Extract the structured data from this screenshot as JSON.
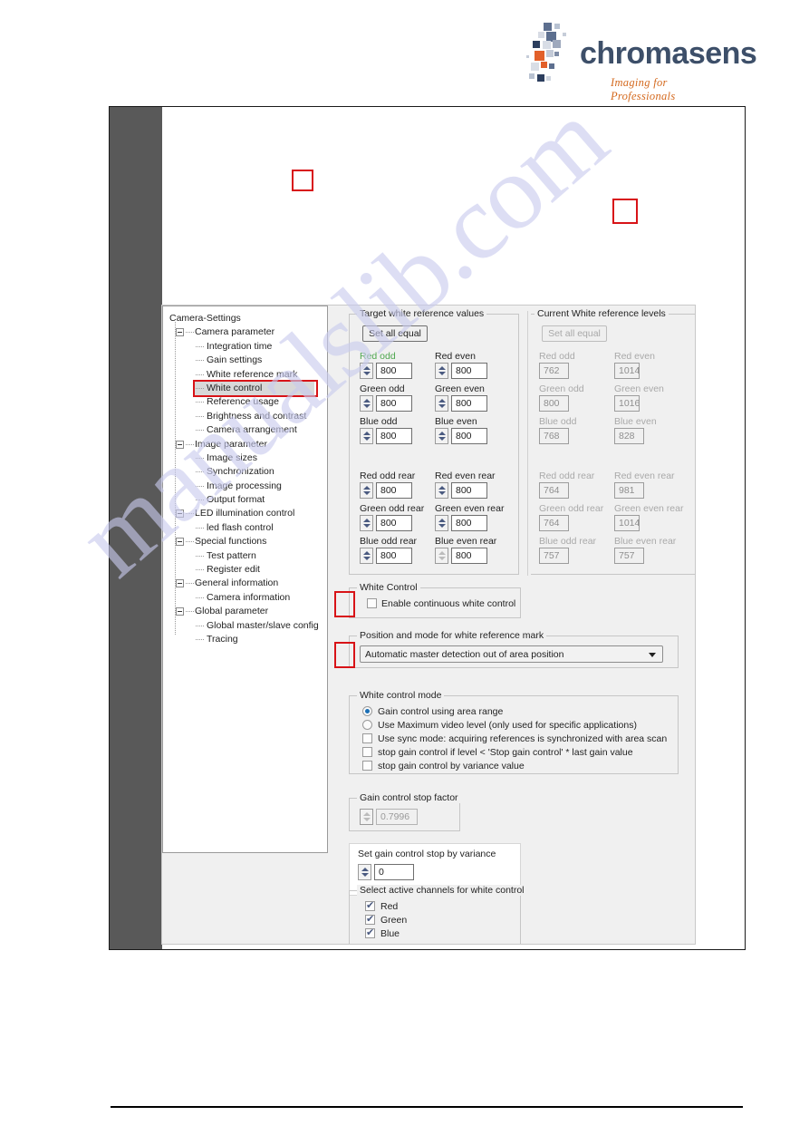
{
  "brand": {
    "name": "chromasens",
    "tagline": "Imaging for Professionals"
  },
  "watermark": "manualslib.com",
  "tree": {
    "root": "Camera-Settings",
    "items": [
      {
        "label": "Camera parameter",
        "depth": 1,
        "expander": true
      },
      {
        "label": "Integration time",
        "depth": 2,
        "expander": false
      },
      {
        "label": "Gain settings",
        "depth": 2,
        "expander": false
      },
      {
        "label": "White reference mark",
        "depth": 2,
        "expander": false
      },
      {
        "label": "White control",
        "depth": 2,
        "expander": false,
        "selected": true
      },
      {
        "label": "Reference usage",
        "depth": 2,
        "expander": false
      },
      {
        "label": "Brightness and contrast",
        "depth": 2,
        "expander": false
      },
      {
        "label": "Camera arrangement",
        "depth": 2,
        "expander": false
      },
      {
        "label": "Image parameter",
        "depth": 1,
        "expander": true
      },
      {
        "label": "Image sizes",
        "depth": 2,
        "expander": false
      },
      {
        "label": "Synchronization",
        "depth": 2,
        "expander": false
      },
      {
        "label": "Image processing",
        "depth": 2,
        "expander": false
      },
      {
        "label": "Output format",
        "depth": 2,
        "expander": false
      },
      {
        "label": "LED illumination control",
        "depth": 1,
        "expander": true
      },
      {
        "label": "led flash control",
        "depth": 2,
        "expander": false
      },
      {
        "label": "Special functions",
        "depth": 1,
        "expander": true
      },
      {
        "label": "Test pattern",
        "depth": 2,
        "expander": false
      },
      {
        "label": "Register edit",
        "depth": 2,
        "expander": false
      },
      {
        "label": "General information",
        "depth": 1,
        "expander": true
      },
      {
        "label": "Camera information",
        "depth": 2,
        "expander": false
      },
      {
        "label": "Global parameter",
        "depth": 1,
        "expander": true
      },
      {
        "label": "Global master/slave config",
        "depth": 2,
        "expander": false
      },
      {
        "label": "Tracing",
        "depth": 2,
        "expander": false
      }
    ]
  },
  "target_panel": {
    "caption": "Target white reference values",
    "set_all_equal": "Set all equal",
    "front": [
      {
        "label": "Red odd",
        "value": "800",
        "highlight": true
      },
      {
        "label": "Red even",
        "value": "800"
      },
      {
        "label": "Green odd",
        "value": "800"
      },
      {
        "label": "Green even",
        "value": "800"
      },
      {
        "label": "Blue odd",
        "value": "800"
      },
      {
        "label": "Blue even",
        "value": "800"
      }
    ],
    "rear": [
      {
        "label": "Red odd rear",
        "value": "800"
      },
      {
        "label": "Red even rear",
        "value": "800"
      },
      {
        "label": "Green odd rear",
        "value": "800"
      },
      {
        "label": "Green even rear",
        "value": "800"
      },
      {
        "label": "Blue odd rear",
        "value": "800"
      },
      {
        "label": "Blue even rear",
        "value": "800"
      }
    ]
  },
  "current_panel": {
    "caption": "Current White reference levels",
    "set_all_equal": "Set all equal",
    "front": [
      {
        "label": "Red odd",
        "value": "762"
      },
      {
        "label": "Red even",
        "value": "1014"
      },
      {
        "label": "Green odd",
        "value": "800"
      },
      {
        "label": "Green even",
        "value": "1016"
      },
      {
        "label": "Blue odd",
        "value": "768"
      },
      {
        "label": "Blue even",
        "value": "828"
      }
    ],
    "rear": [
      {
        "label": "Red odd rear",
        "value": "764"
      },
      {
        "label": "Red even rear",
        "value": "981"
      },
      {
        "label": "Green odd rear",
        "value": "764"
      },
      {
        "label": "Green even rear",
        "value": "1014"
      },
      {
        "label": "Blue odd rear",
        "value": "757"
      },
      {
        "label": "Blue even rear",
        "value": "757"
      }
    ]
  },
  "white_control": {
    "caption": "White Control",
    "enable_label": "Enable continuous white control",
    "enable_checked": false
  },
  "position_mode": {
    "caption": "Position and mode for white reference mark",
    "selected": "Automatic master detection out of area position"
  },
  "white_control_mode": {
    "caption": "White control mode",
    "options": [
      {
        "type": "radio",
        "label": "Gain control using area range",
        "checked": true
      },
      {
        "type": "radio",
        "label": "Use Maximum video level  (only used for specific applications)",
        "checked": false
      },
      {
        "type": "checkbox",
        "label": "Use sync mode: acquiring references is synchronized with area scan",
        "checked": false
      },
      {
        "type": "checkbox",
        "label": "stop gain control if level < 'Stop gain control' * last gain value",
        "checked": false
      },
      {
        "type": "checkbox",
        "label": "stop gain control by variance value",
        "checked": false
      }
    ]
  },
  "gain_stop_factor": {
    "caption": "Gain control stop factor",
    "value": "0.7996",
    "disabled": true
  },
  "gain_stop_variance": {
    "label": "Set gain control stop by variance",
    "value": "0"
  },
  "channels": {
    "caption": "Select active channels for white control",
    "items": [
      {
        "label": "Red",
        "checked": true
      },
      {
        "label": "Green",
        "checked": true
      },
      {
        "label": "Blue",
        "checked": true
      }
    ]
  },
  "colors": {
    "accent_red": "#d81317",
    "brand_blue": "#3d4f69",
    "brand_orange": "#d4691e",
    "highlight_green": "#4da64d"
  }
}
